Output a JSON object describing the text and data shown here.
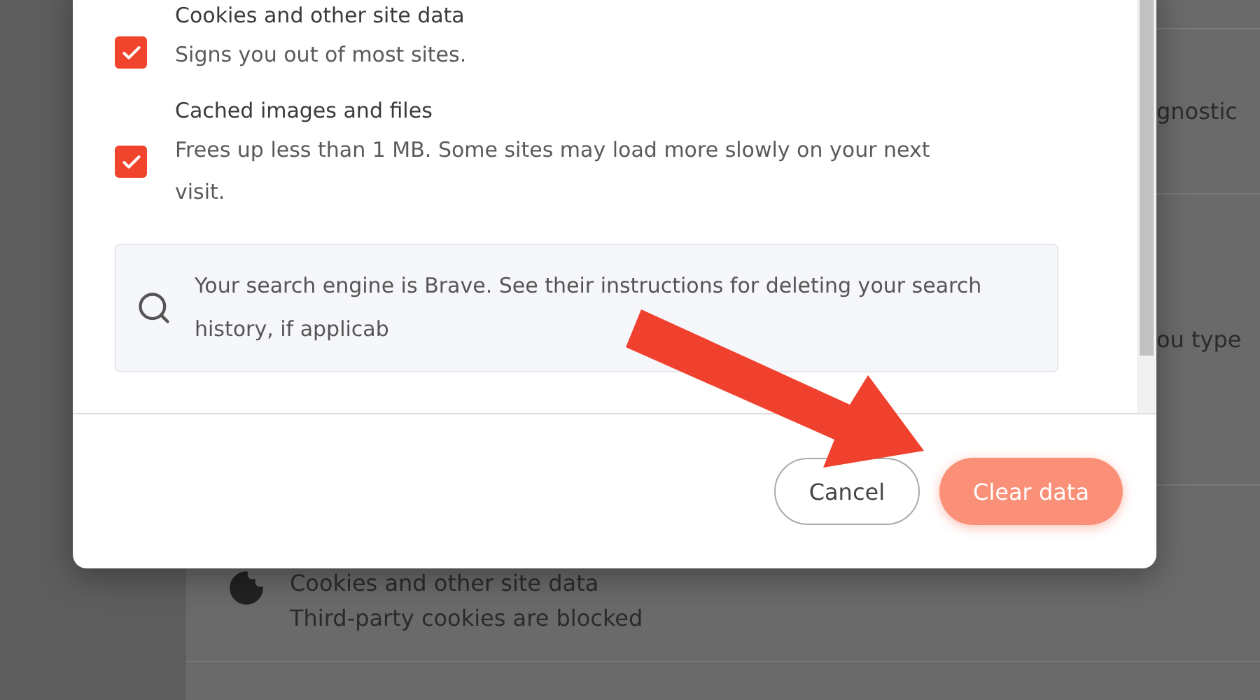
{
  "background": {
    "rows": [
      {
        "kind": "text",
        "text": "gnostic"
      },
      {
        "kind": "text",
        "text": "ou type"
      },
      {
        "kind": "item",
        "title": "Cookies and other site data",
        "subtitle": "Third-party cookies are blocked"
      }
    ]
  },
  "dialog": {
    "options": [
      {
        "title": "Cookies and other site data",
        "description": "Signs you out of most sites.",
        "checked": true
      },
      {
        "title": "Cached images and files",
        "description": "Frees up less than 1 MB. Some sites may load more slowly on your next visit.",
        "checked": true
      }
    ],
    "notice": "Your search engine is Brave. See their instructions for deleting your search history, if applicab",
    "buttons": [
      {
        "kind": "secondary",
        "label": "Cancel"
      },
      {
        "kind": "primary",
        "label": "Clear data"
      }
    ]
  }
}
